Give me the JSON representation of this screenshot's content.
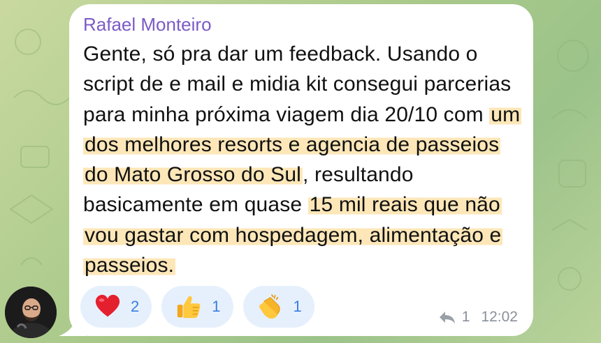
{
  "message": {
    "sender": "Rafael Monteiro",
    "text_parts": [
      "Gente, só pra dar um feedback. Usando o script de e mail e midia kit consegui parcerias para minha próxima viagem dia 20/10 com ",
      "um dos melhores resorts e agencia de passeios do Mato Grosso do Sul",
      ", resultando basicamente em quase ",
      "15 mil reais que não vou gastar com hospedagem, alimentação e passeios."
    ],
    "reactions": [
      {
        "emoji": "heart-icon",
        "count": "2"
      },
      {
        "emoji": "thumbs-up-icon",
        "count": "1"
      },
      {
        "emoji": "clapping-hands-icon",
        "count": "1"
      }
    ],
    "reply_count": "1",
    "time": "12:02"
  },
  "colors": {
    "sender": "#7b5bc6",
    "highlight": "#fde7b8",
    "reaction_bg": "#e6f0fd",
    "reaction_count": "#3b7de0",
    "meta": "#8a9099"
  }
}
